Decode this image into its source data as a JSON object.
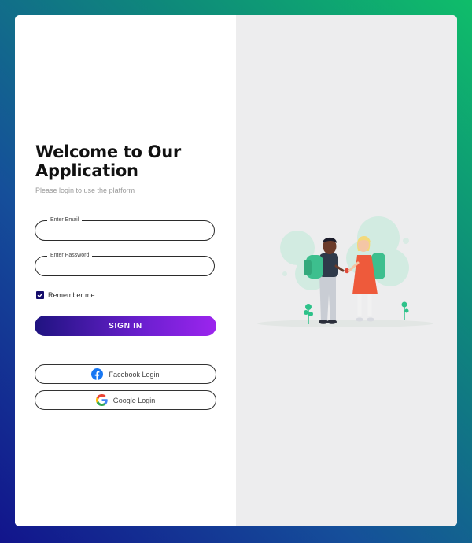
{
  "login": {
    "title_line1": "Welcome to Our",
    "title_line2": "Application",
    "subtitle": "Please login to use the platform",
    "email_label": "Enter Email",
    "email_value": "",
    "password_label": "Enter Password",
    "password_value": "",
    "remember_label": "Remember me",
    "remember_checked": true,
    "signin_label": "SIGN IN",
    "facebook_label": "Facebook Login",
    "google_label": "Google Login"
  },
  "illustration": {
    "icon": "kids-with-backpacks-illustration"
  },
  "colors": {
    "accent_start": "#1f1380",
    "accent_end": "#9c25ee",
    "checkbox": "#140c6b",
    "panel_bg": "#ededee",
    "facebook": "#1877f2"
  }
}
